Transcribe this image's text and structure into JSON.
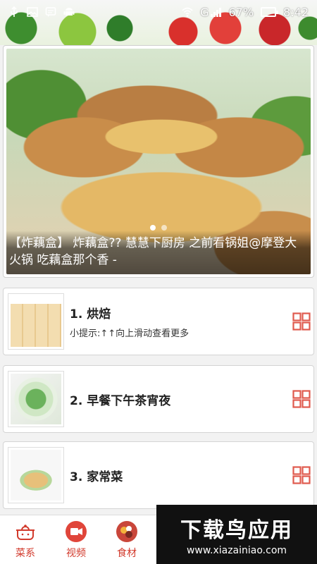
{
  "status_bar": {
    "network_label": "G",
    "battery": "67%",
    "time": "8:42"
  },
  "banner": {
    "caption": "【炸藕盒】 炸藕盒?? 慧慧下厨房 之前看锅姐@摩登大火锅 吃藕盒那个香 -",
    "slide_count": 2,
    "active_slide": 1
  },
  "categories": [
    {
      "title": "1. 烘焙",
      "hint": "小提示:↑↑向上滑动查看更多"
    },
    {
      "title": "2. 早餐下午茶宵夜",
      "hint": ""
    },
    {
      "title": "3. 家常菜",
      "hint": ""
    }
  ],
  "bottom_nav": [
    {
      "label": "菜系",
      "icon": "pot-icon"
    },
    {
      "label": "视频",
      "icon": "video-icon"
    },
    {
      "label": "食材",
      "icon": "ingredients-icon"
    }
  ],
  "watermark": {
    "title": "下载鸟应用",
    "url": "www.xiazainiao.com"
  },
  "colors": {
    "accent": "#d23a2c",
    "grid_icon": "#e05a4e"
  }
}
